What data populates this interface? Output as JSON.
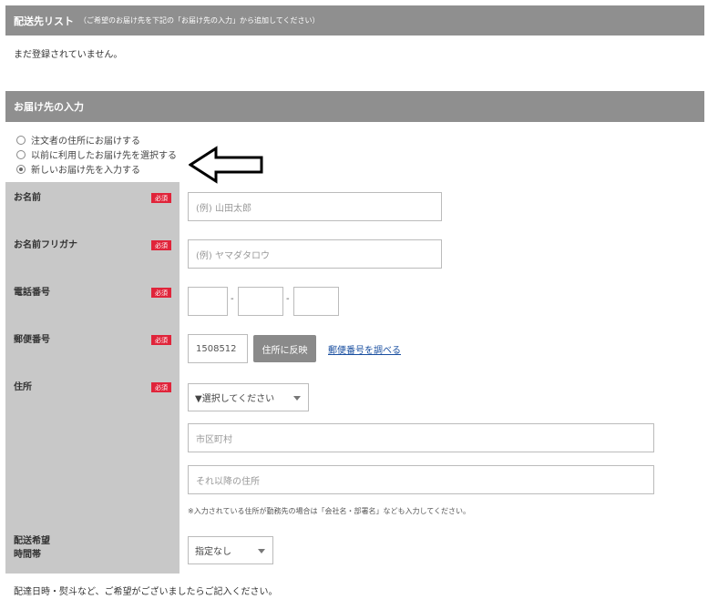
{
  "delivery_list": {
    "title": "配送先リスト",
    "subtitle": "（ご希望のお届け先を下記の「お届け先の入力」から追加してください）",
    "empty_message": "まだ登録されていません。"
  },
  "destination": {
    "title": "お届け先の入力",
    "options": [
      {
        "label": "注文者の住所にお届けする",
        "checked": false
      },
      {
        "label": "以前に利用したお届け先を選択する",
        "checked": false
      },
      {
        "label": "新しいお届け先を入力する",
        "checked": true
      }
    ]
  },
  "form": {
    "required_badge": "必須",
    "name": {
      "label": "お名前",
      "placeholder": "(例) 山田太郎"
    },
    "kana": {
      "label": "お名前フリガナ",
      "placeholder": "(例) ヤマダタロウ"
    },
    "phone": {
      "label": "電話番号",
      "dash": "-"
    },
    "postal": {
      "label": "郵便番号",
      "value": "1508512",
      "apply_button": "住所に反映",
      "lookup_link": "郵便番号を調べる"
    },
    "address": {
      "label": "住所",
      "prefecture_select": "▼選択してください",
      "city_placeholder": "市区町村",
      "rest_placeholder": "それ以降の住所",
      "note": "※入力されている住所が勤務先の場合は「会社名・部署名」なども入力してください。"
    },
    "time": {
      "label_line1": "配送希望",
      "label_line2": "時間帯",
      "selected": "指定なし"
    }
  },
  "footer_text": "配達日時・熨斗など、ご希望がございましたらご記入ください。"
}
